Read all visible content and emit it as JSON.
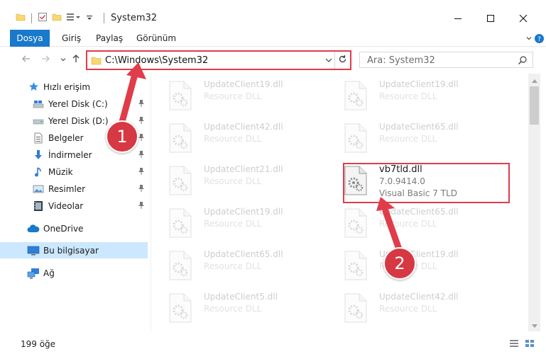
{
  "window": {
    "title": "System32",
    "minimize_icon": "minimize-icon",
    "maximize_icon": "maximize-icon",
    "close_icon": "close-icon"
  },
  "ribbon": {
    "tabs": [
      "Dosya",
      "Giriş",
      "Paylaş",
      "Görünüm"
    ]
  },
  "address_bar": {
    "path": "C:\\Windows\\System32"
  },
  "search": {
    "placeholder": "Ara: System32"
  },
  "sidebar": {
    "quick_access": "Hızlı erişim",
    "items": [
      {
        "label": "Yerel Disk (C:)",
        "icon": "drive-icon",
        "pinned": true
      },
      {
        "label": "Yerel Disk (D:)",
        "icon": "drive-icon",
        "pinned": true
      },
      {
        "label": "Belgeler",
        "icon": "documents-icon",
        "pinned": true
      },
      {
        "label": "İndirmeler",
        "icon": "download-icon",
        "pinned": true
      },
      {
        "label": "Müzik",
        "icon": "music-icon",
        "pinned": true
      },
      {
        "label": "Resimler",
        "icon": "pictures-icon",
        "pinned": true
      },
      {
        "label": "Videolar",
        "icon": "videos-icon",
        "pinned": true
      }
    ],
    "onedrive": "OneDrive",
    "this_pc": "Bu bilgisayar",
    "network": "Ağ"
  },
  "files": [
    {
      "name": "UpdateClient19.dll",
      "type": "Resource DLL",
      "faded": true
    },
    {
      "name": "UpdateClient19.dll",
      "type": "Resource DLL",
      "faded": true
    },
    {
      "name": "UpdateClient42.dll",
      "type": "Resource DLL",
      "faded": true
    },
    {
      "name": "UpdateClient65.dll",
      "type": "Resource DLL",
      "faded": true
    },
    {
      "name": "UpdateClient21.dll",
      "type": "Resource DLL",
      "faded": true
    },
    {
      "name": "vb7tld.dll",
      "version": "7.0.9414.0",
      "type": "Visual Basic 7 TLD",
      "faded": false
    },
    {
      "name": "UpdateClient19.dll",
      "type": "Resource DLL",
      "faded": true
    },
    {
      "name": "UpdateClient65.dll",
      "type": "Resource DLL",
      "faded": true
    },
    {
      "name": "UpdateClient65.dll",
      "type": "Resource DLL",
      "faded": true
    },
    {
      "name": "UpdateClient19.dll",
      "type": "Resource DLL",
      "faded": true
    },
    {
      "name": "UpdateClient5.dll",
      "type": "Resource DLL",
      "faded": true
    },
    {
      "name": "UpdateClient42.dll",
      "type": "Resource DLL",
      "faded": true
    }
  ],
  "callouts": [
    "1",
    "2"
  ],
  "status": {
    "item_count": "199 öğe"
  },
  "colors": {
    "accent": "#1979ca",
    "highlight": "#e03c4a",
    "selected_bg": "#cce8ff"
  }
}
